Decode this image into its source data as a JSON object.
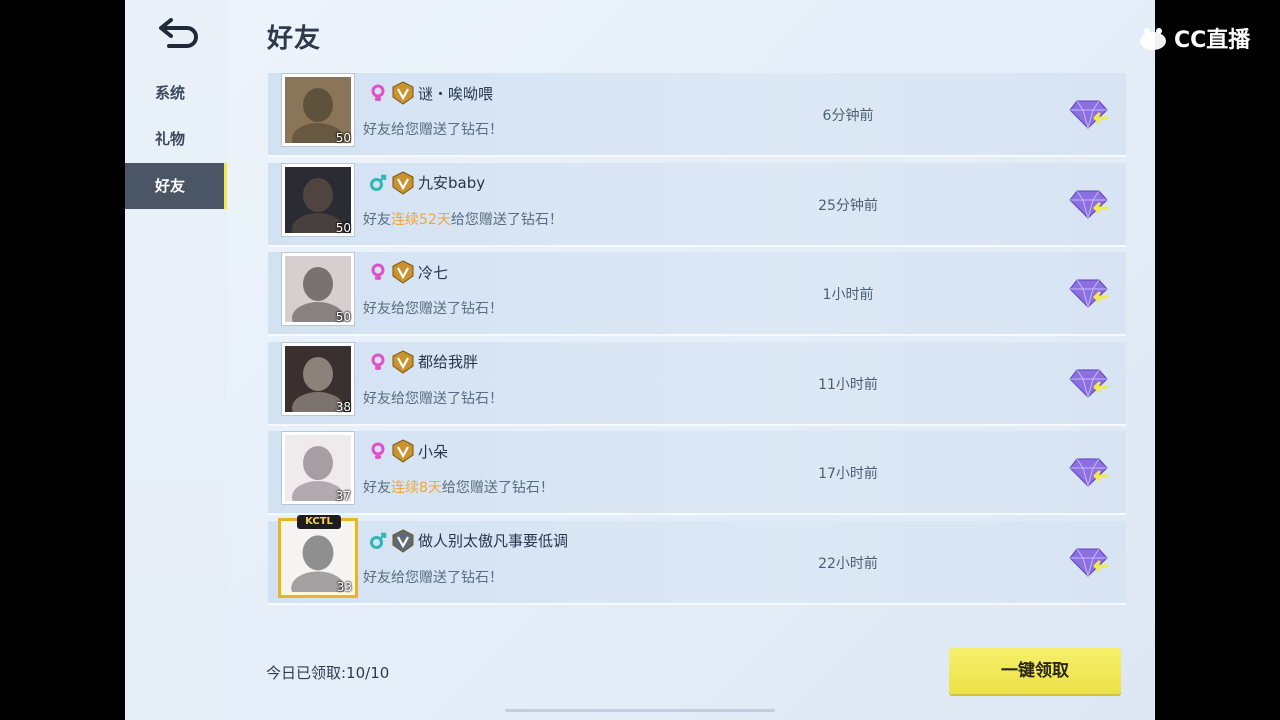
{
  "watermark": {
    "label": "CC直播"
  },
  "page_title": "好友",
  "sidebar": {
    "items": [
      {
        "label": "系统",
        "active": false
      },
      {
        "label": "礼物",
        "active": false
      },
      {
        "label": "好友",
        "active": true
      }
    ]
  },
  "friends": [
    {
      "name": "谜・唉呦喂",
      "gender": "female",
      "level": "50",
      "msg_pre": "好友给您赠送了钻石！",
      "msg_hl": "",
      "msg_post": "",
      "time": "6分钟前"
    },
    {
      "name": "九安baby",
      "gender": "male",
      "level": "50",
      "msg_pre": "好友",
      "msg_hl": "连续52天",
      "msg_post": "给您赠送了钻石！",
      "time": "25分钟前"
    },
    {
      "name": "冷七",
      "gender": "female",
      "level": "50",
      "msg_pre": "好友给您赠送了钻石！",
      "msg_hl": "",
      "msg_post": "",
      "time": "1小时前"
    },
    {
      "name": "都给我胖",
      "gender": "female",
      "level": "38",
      "msg_pre": "好友给您赠送了钻石！",
      "msg_hl": "",
      "msg_post": "",
      "time": "11小时前"
    },
    {
      "name": "小朵",
      "gender": "female",
      "level": "37",
      "msg_pre": "好友",
      "msg_hl": "连续8天",
      "msg_post": "给您赠送了钻石！",
      "time": "17小时前"
    },
    {
      "name": "做人别太傲凡事要低调",
      "gender": "male",
      "level": "33",
      "msg_pre": "好友给您赠送了钻石！",
      "msg_hl": "",
      "msg_post": "",
      "time": "22小时前",
      "frame_tag": "KCTL"
    }
  ],
  "footer": {
    "claimed_label": "今日已领取:10/10",
    "claim_all_label": "一键领取"
  },
  "colors": {
    "accent_yellow": "#f2e94a",
    "highlight_orange": "#f0a63a",
    "female_pink": "#e04fc8",
    "male_teal": "#2fb7b4"
  }
}
